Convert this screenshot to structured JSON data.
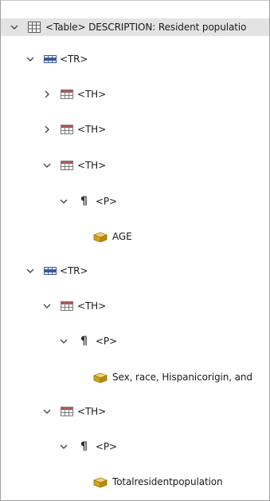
{
  "tree": {
    "root": {
      "label": "<Table> DESCRIPTION: Resident populatio"
    },
    "tr1": {
      "label": "<TR>"
    },
    "tr1_th1": {
      "label": "<TH>"
    },
    "tr1_th2": {
      "label": "<TH>"
    },
    "tr1_th3": {
      "label": "<TH>"
    },
    "tr1_th3_p": {
      "label": "<P>"
    },
    "tr1_th3_p_content": {
      "label": "AGE"
    },
    "tr2": {
      "label": "<TR>"
    },
    "tr2_th1": {
      "label": "<TH>"
    },
    "tr2_th1_p": {
      "label": "<P>"
    },
    "tr2_th1_p_content": {
      "label": "Sex, race, Hispanicorigin, and"
    },
    "tr2_th2": {
      "label": "<TH>"
    },
    "tr2_th2_p": {
      "label": "<P>"
    },
    "tr2_th2_p_content": {
      "label": "Totalresidentpopulation"
    }
  },
  "icons": {
    "expanded": "chevron-down-icon",
    "collapsed": "chevron-right-icon",
    "table": "table-grid-icon",
    "row": "table-row-icon",
    "header_cell": "table-header-cell-icon",
    "paragraph": "pilcrow-icon",
    "content": "content-box-icon"
  },
  "colors": {
    "selected_row": "#e3e3e3",
    "chevron": "#4a4a4a",
    "th_red": "#c0504d",
    "grid_blue": "#3c5a9a",
    "content_gold": "#d4a017"
  }
}
